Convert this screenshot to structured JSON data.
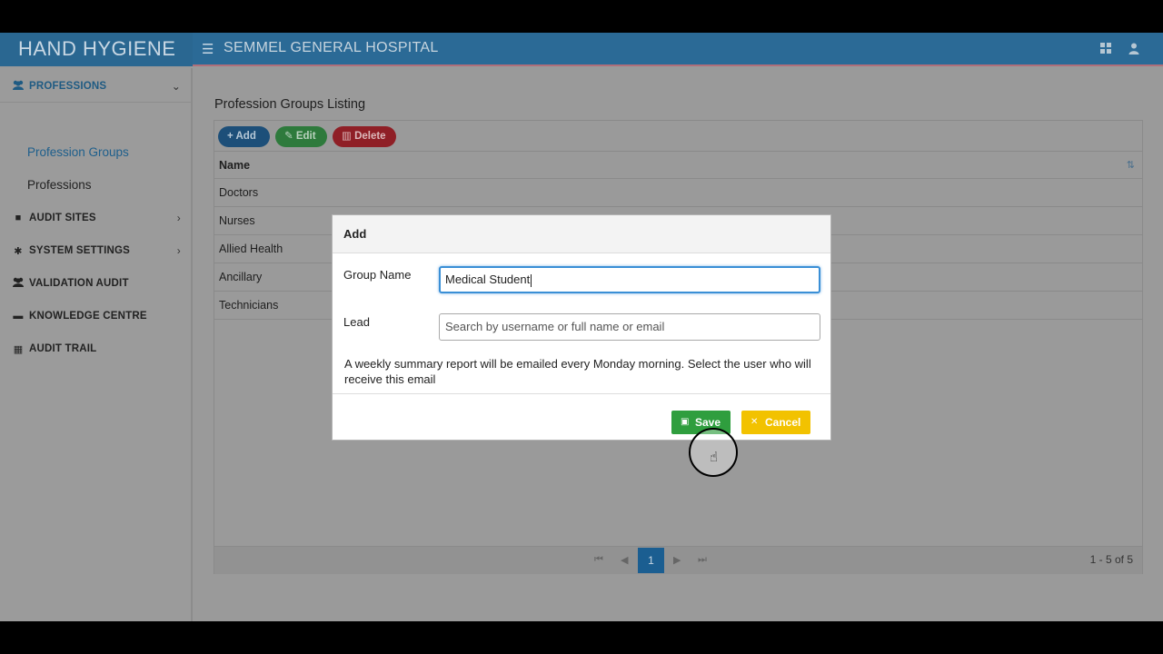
{
  "header": {
    "brand": "HAND HYGIENE",
    "hospital": "SEMMEL GENERAL HOSPITAL",
    "icons": [
      "menu-icon",
      "apps-icon",
      "user-icon"
    ]
  },
  "sidebar": {
    "sections": [
      {
        "label": "PROFESSIONS",
        "icon": "users-icon"
      },
      {
        "label": "AUDIT SITES",
        "icon": "book-icon"
      },
      {
        "label": "SYSTEM SETTINGS",
        "icon": "gear-icon"
      },
      {
        "label": "VALIDATION AUDIT",
        "icon": "users-icon"
      },
      {
        "label": "KNOWLEDGE CENTRE",
        "icon": "folder-icon"
      },
      {
        "label": "AUDIT TRAIL",
        "icon": "calendar-icon"
      }
    ],
    "sub_items": [
      "Profession Groups",
      "Professions"
    ]
  },
  "main": {
    "title": "Profession Groups Listing",
    "toolbar": {
      "add": "Add",
      "edit": "Edit",
      "delete": "Delete"
    },
    "grid": {
      "column": "Name",
      "rows": [
        "Doctors",
        "Nurses",
        "Allied Health",
        "Ancillary",
        "Technicians"
      ]
    },
    "pager": {
      "current_page": "1",
      "info": "1 - 5 of 5"
    }
  },
  "modal": {
    "title": "Add",
    "group_name_label": "Group Name",
    "group_name_value": "Medical Student",
    "lead_label": "Lead",
    "lead_placeholder": "Search by username or full name or email",
    "hint": "A weekly summary report will be emailed every Monday morning. Select the user who will receive this email",
    "save": "Save",
    "cancel": "Cancel"
  },
  "colors": {
    "header": "#2b6a96",
    "primary": "#1b5e91",
    "save": "#2f9e3e",
    "cancel": "#f2c200",
    "delete": "#8f1f26"
  }
}
